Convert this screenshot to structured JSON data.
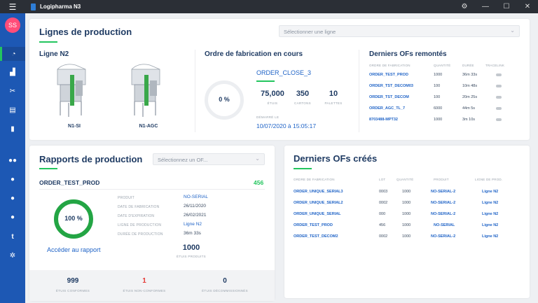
{
  "app": {
    "title": "Logipharma N3",
    "avatar": "SS"
  },
  "titlebar": {
    "menu_icon": "☰",
    "gear": "⚙",
    "minimize": "—",
    "maximize": "☐",
    "close": "✕"
  },
  "sidebar": {
    "items": [
      {
        "icon": "dashboard-icon",
        "glyph": "◔"
      },
      {
        "icon": "factory-icon",
        "glyph": "▟"
      },
      {
        "icon": "tools-icon",
        "glyph": "✂"
      },
      {
        "icon": "archive-icon",
        "glyph": "▤"
      },
      {
        "icon": "document-icon",
        "glyph": "▮"
      },
      {
        "icon": "users-group-icon",
        "glyph": "●●"
      },
      {
        "icon": "user-add-icon",
        "glyph": "●"
      },
      {
        "icon": "user-settings-icon",
        "glyph": "●"
      },
      {
        "icon": "user-key-icon",
        "glyph": "●"
      },
      {
        "icon": "letter-t-icon",
        "glyph": "t"
      },
      {
        "icon": "settings-cogs-icon",
        "glyph": "✲"
      }
    ]
  },
  "lignes": {
    "title": "Lignes de production",
    "select_placeholder": "Sélectionner une ligne",
    "line_name": "Ligne N2",
    "machines": [
      "N1-SI",
      "N1-AGC"
    ],
    "of_title": "Ordre de fabrication en cours",
    "of_percent": "0 %",
    "of_order": "ORDER_CLOSE_3",
    "stats": [
      {
        "value": "75,000",
        "label": "ÉTUIS"
      },
      {
        "value": "350",
        "label": "CARTONS"
      },
      {
        "value": "10",
        "label": "PALETTES"
      }
    ],
    "started_label": "DÉMARRÉ LE",
    "started_value": "10/07/2020 à 15:05:17",
    "remontes_title": "Derniers OFs remontés",
    "remontes_headers": [
      "ORDRE DE FABRICATION",
      "QUANTITÉ",
      "DURÉE",
      "TRACELINK"
    ],
    "remontes_rows": [
      {
        "order": "ORDER_TEST_PROD",
        "qty": "1000",
        "duration": "36m 33s"
      },
      {
        "order": "ORDER_TST_DECOM03",
        "qty": "100",
        "duration": "10m 48s"
      },
      {
        "order": "ORDER_TST_DECOM",
        "qty": "100",
        "duration": "20m 25s"
      },
      {
        "order": "ORDER_AGC_TL_7",
        "qty": "6000",
        "duration": "44m 5s"
      },
      {
        "order": "8703488-MPT32",
        "qty": "1000",
        "duration": "3m 10s"
      }
    ]
  },
  "rapports": {
    "title": "Rapports de production",
    "select_placeholder": "Sélectionnez un OF...",
    "order": "ORDER_TEST_PROD",
    "order_count": "456",
    "percent": "100 %",
    "progress_fraction": 1.0,
    "link": "Accéder au rapport",
    "details": [
      {
        "key": "PRODUIT",
        "value": "NO-SERIAL",
        "link": true
      },
      {
        "key": "DATE DE FABRICATION",
        "value": "26/11/2020",
        "link": false
      },
      {
        "key": "DATE D'EXPIRATION",
        "value": "26/02/2021",
        "link": false
      },
      {
        "key": "LIGNE DE PRODUCTION",
        "value": "Ligne N2",
        "link": true
      },
      {
        "key": "DURÉE DE PRODUCTION",
        "value": "36m 33s",
        "link": false
      }
    ],
    "produced_value": "1000",
    "produced_label": "ÉTUIS PRODUITS",
    "footer": [
      {
        "value": "999",
        "label": "ÉTUIS CONFORMES",
        "color": "#1f3b63"
      },
      {
        "value": "1",
        "label": "ÉTUIS NON-CONFORMES",
        "color": "#e53935"
      },
      {
        "value": "0",
        "label": "ÉTUIS DÉCOMMISSIONNÉS",
        "color": "#1f3b63"
      }
    ]
  },
  "crees": {
    "title": "Derniers OFs créés",
    "headers": [
      "ORDRE DE FABRICATION",
      "LOT",
      "QUANTITÉ",
      "PRODUIT",
      "LIGNE DE PROD."
    ],
    "rows": [
      {
        "order": "ORDER_UNIQUE_SERIAL3",
        "lot": "0003",
        "qty": "1000",
        "product": "NO-SERIAL-2",
        "line": "Ligne N2"
      },
      {
        "order": "ORDER_UNIQUE_SERIAL2",
        "lot": "0002",
        "qty": "1000",
        "product": "NO-SERIAL-2",
        "line": "Ligne N2"
      },
      {
        "order": "ORDER_UNIQUE_SERIAL",
        "lot": "000",
        "qty": "1000",
        "product": "NO-SERIAL-2",
        "line": "Ligne N2"
      },
      {
        "order": "ORDER_TEST_PROD",
        "lot": "456",
        "qty": "1000",
        "product": "NO-SERIAL",
        "line": "Ligne N2"
      },
      {
        "order": "ORDER_TEST_DECOM2",
        "lot": "0002",
        "qty": "1000",
        "product": "NO-SERIAL-2",
        "line": "Ligne N2"
      }
    ]
  },
  "colors": {
    "sidebar": "#1d58b4",
    "accent_green": "#23c55e",
    "link_blue": "#2064c7",
    "avatar": "#ff4d79",
    "error_red": "#e53935"
  }
}
